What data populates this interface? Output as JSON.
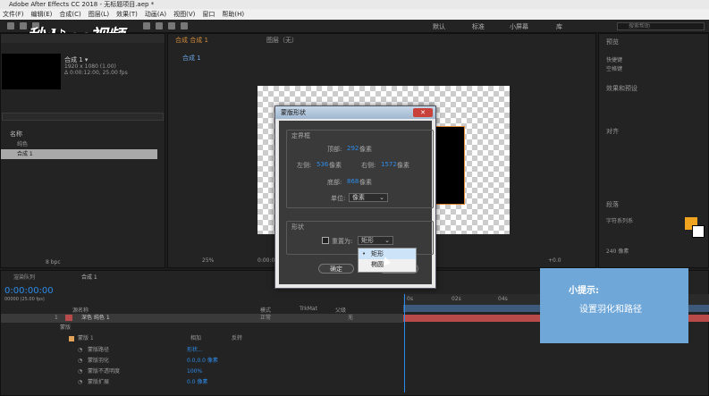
{
  "app": {
    "title": "Adobe After Effects CC 2018 - 无标题项目.aep *"
  },
  "menu": [
    "文件(F)",
    "编辑(E)",
    "合成(C)",
    "图层(L)",
    "效果(T)",
    "动画(A)",
    "视图(V)",
    "窗口",
    "帮助(H)"
  ],
  "workspaces": [
    "默认",
    "标准",
    "小屏幕",
    "库"
  ],
  "search_help": "搜索帮助",
  "logo": "秒d♪ng视频",
  "project": {
    "comp_name": "合成 1 ▾",
    "comp_info_1": "1920 x 1080 (1.00)",
    "comp_info_2": "Δ 0:00:12:00, 25.00 fps",
    "column_name": "名称",
    "items": [
      "纯色",
      "合成 1"
    ],
    "bpc": "8 bpc"
  },
  "viewer": {
    "tab_comp": "合成 合成 1",
    "tab_layer": "图层（无）",
    "comp_label": "合成 1",
    "zoom": "25%",
    "timecode_small": "0:00:00:00",
    "offset": "+0.0"
  },
  "dialog": {
    "title": "蒙版形状",
    "close": "✕",
    "bbox_group": "定界框",
    "top_label": "顶部:",
    "top_value": "292",
    "left_label": "左侧:",
    "left_value": "536",
    "right_label": "右侧:",
    "right_value": "1572",
    "bottom_label": "底部:",
    "bottom_value": "868",
    "unit_px": "像素",
    "units_label": "单位:",
    "units_value": "像素",
    "shape_group": "形状",
    "reset_label": "重置为:",
    "reset_value": "矩形",
    "ok": "确定",
    "cancel": "取消"
  },
  "popup": [
    "矩形",
    "椭圆"
  ],
  "right_panels": {
    "preview": "预览",
    "shortcut": "快捷键",
    "shortcut_value": "空格键",
    "effects": "效果和预设",
    "align": "对齐",
    "paragraph": "段落",
    "char_label": "字体",
    "char_value": "字符系列系",
    "size_value": "240 像素"
  },
  "timeline": {
    "tab_render": "渲染队列",
    "tab_comp": "合成 1",
    "timecode": "0:00:00:00",
    "timecode_sub": "00000 (25.00 fps)",
    "col_source": "源名称",
    "col_mode": "模式",
    "col_trkmat": "TrkMat",
    "col_parent": "父级",
    "layer_num": "1",
    "layer_name": "深色 纯色 1",
    "layer_mode": "正常",
    "layer_parent": "无",
    "mask_group": "蒙版",
    "mask_name": "蒙版 1",
    "mask_mode": "相加",
    "mask_invert": "反转",
    "mask_path": "蒙版路径",
    "mask_path_val": "形状...",
    "mask_feather": "蒙版羽化",
    "mask_feather_val": "0.0,0.0 像素",
    "mask_opacity": "蒙版不透明度",
    "mask_opacity_val": "100%",
    "mask_expand": "蒙版扩展",
    "mask_expand_val": "0.0 像素",
    "ruler": [
      "0s",
      "02s",
      "04s"
    ]
  },
  "tip": {
    "title": "小提示:",
    "text": "设置羽化和路径"
  },
  "colors": {
    "accent": "#2d8ceb",
    "tip_bg": "#6fa7d9",
    "layer_bar": "#b84a4a"
  }
}
